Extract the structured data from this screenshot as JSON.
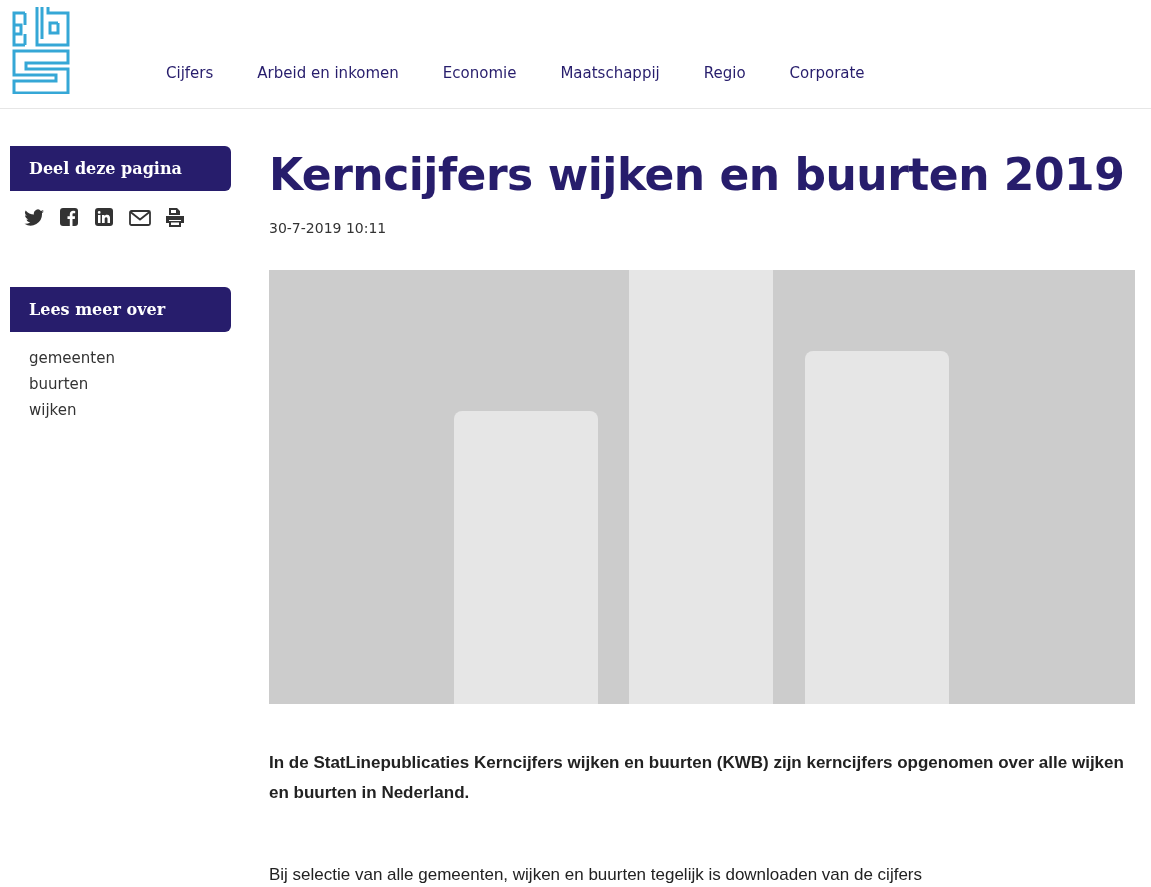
{
  "nav": {
    "items": [
      {
        "label": "Cijfers"
      },
      {
        "label": "Arbeid en inkomen"
      },
      {
        "label": "Economie"
      },
      {
        "label": "Maatschappij"
      },
      {
        "label": "Regio"
      },
      {
        "label": "Corporate"
      }
    ]
  },
  "sidebar": {
    "share": {
      "title": "Deel deze pagina",
      "icons": [
        {
          "kind": "twitter"
        },
        {
          "kind": "facebook"
        },
        {
          "kind": "linkedin"
        },
        {
          "kind": "mail"
        },
        {
          "kind": "print"
        }
      ]
    },
    "read_more": {
      "title": "Lees meer over",
      "links": [
        "gemeenten",
        "buurten",
        "wijken"
      ]
    }
  },
  "article": {
    "title": "Kerncijfers wijken en buurten 2019",
    "date": "30-7-2019 10:11",
    "intro": "In de StatLinepublicaties Kerncijfers wijken en buurten (KWB) zijn kerncijfers opgenomen over alle wijken en buurten in Nederland.",
    "body": "Bij selectie van alle gemeenten, wijken en buurten tegelijk is downloaden van de cijfers"
  }
}
